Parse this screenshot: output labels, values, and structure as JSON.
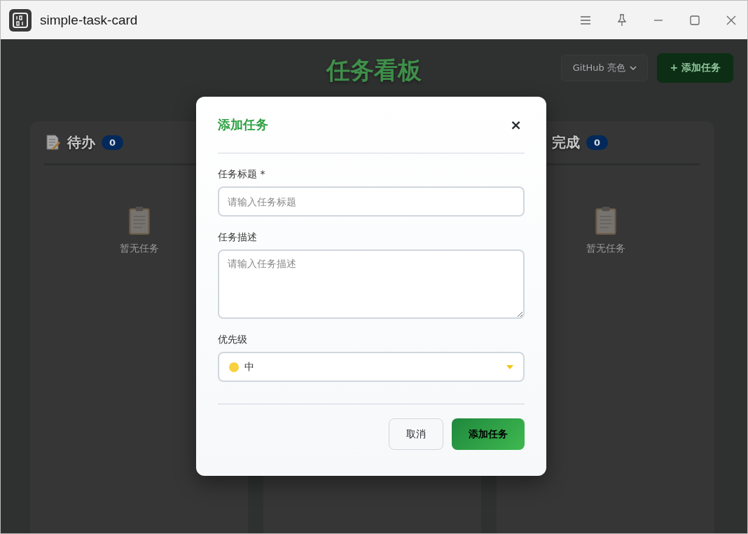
{
  "window": {
    "title": "simple-task-card"
  },
  "page": {
    "heading": "任务看板",
    "theme_select": "GitHub 亮色",
    "add_button": "+ 添加任务"
  },
  "columns": [
    {
      "title": "待办",
      "count": "0",
      "empty_text": "暂无任务",
      "icon": true
    },
    {},
    {
      "title": "完成",
      "count": "0",
      "empty_text": "暂无任务",
      "icon": false
    }
  ],
  "dialog": {
    "title": "添加任务",
    "close": "×",
    "fields": [
      {
        "kind": "input",
        "label": "任务标题 *",
        "placeholder": "请输入任务标题"
      },
      {
        "kind": "textarea",
        "label": "任务描述",
        "placeholder": "请输入任务描述"
      },
      {
        "kind": "select",
        "label": "优先级",
        "value": "中",
        "color": "#f9d13e"
      }
    ],
    "buttons": [
      {
        "label": "取消",
        "kind": "secondary"
      },
      {
        "label": "添加任务",
        "kind": "primary"
      }
    ]
  }
}
